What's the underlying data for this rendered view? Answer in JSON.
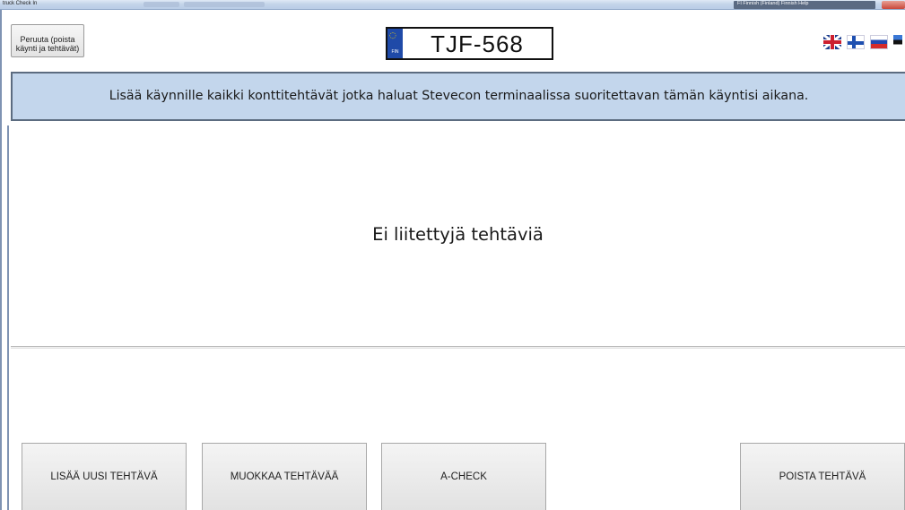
{
  "window": {
    "title": "truck Check In",
    "taskbar_lang": "FI Finnish (Finland)   Finnish   Help"
  },
  "header": {
    "cancel_button": "Peruuta (poista\nkäynti ja tehtävät)",
    "plate": {
      "country": "FIN",
      "number": "TJF-568"
    },
    "flags": [
      "uk-flag-icon",
      "finland-flag-icon",
      "russia-flag-icon",
      "estonia-flag-icon"
    ]
  },
  "banner": {
    "text": "Lisää käynnille kaikki konttitehtävät jotka haluat Stevecon terminaalissa suoritettavan tämän käyntisi aikana."
  },
  "tasks": {
    "empty_message": "Ei liitettyjä tehtäviä"
  },
  "actions": {
    "add": "LISÄÄ UUSI TEHTÄVÄ",
    "edit": "MUOKKAA TEHTÄVÄÄ",
    "acheck": "A-CHECK",
    "delete": "POISTA TEHTÄVÄ"
  },
  "colors": {
    "banner_bg": "#c3d6ec",
    "banner_border": "#5c6c80",
    "plate_eu_blue": "#1f4aa8"
  }
}
